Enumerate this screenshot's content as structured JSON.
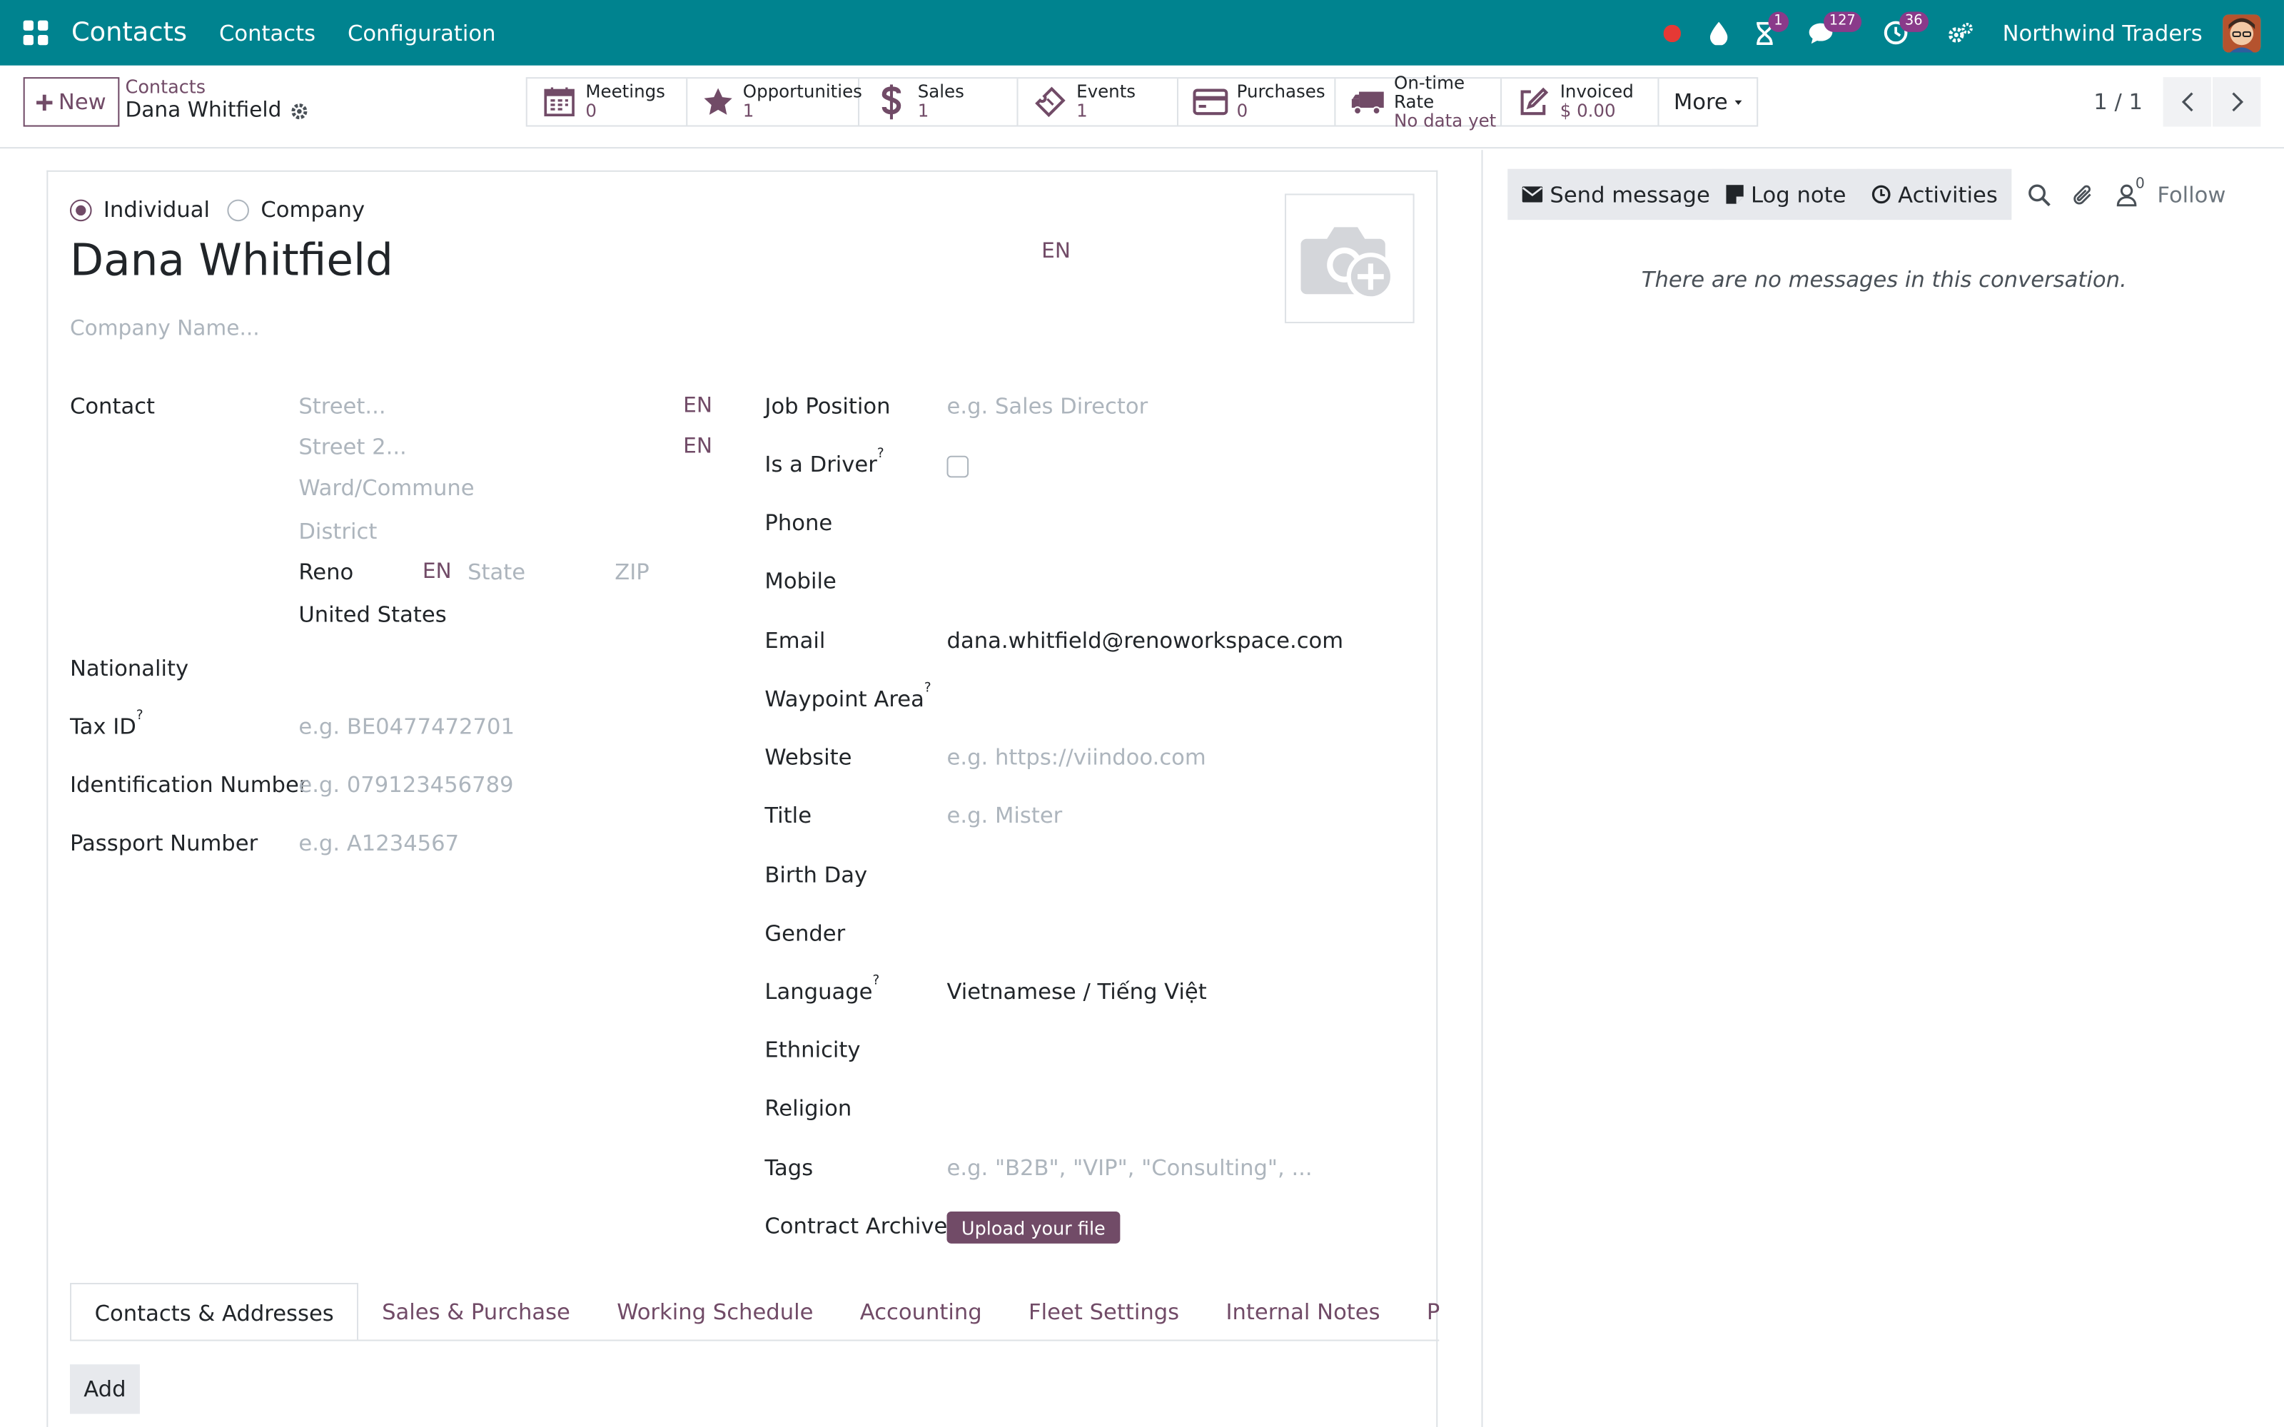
{
  "navbar": {
    "brand": "Contacts",
    "menus": [
      "Contacts",
      "Configuration"
    ],
    "badges": {
      "activities": "1",
      "messages": "127",
      "clock": "36"
    },
    "company": "Northwind Traders"
  },
  "control": {
    "new_label": "New",
    "breadcrumb_parent": "Contacts",
    "breadcrumb_current": "Dana Whitfield",
    "stats": [
      {
        "label": "Meetings",
        "value": "0",
        "icon": "calendar-icon"
      },
      {
        "label": "Opportunities",
        "value": "1",
        "icon": "star-icon"
      },
      {
        "label": "Sales",
        "value": "1",
        "icon": "dollar-icon"
      },
      {
        "label": "Events",
        "value": "1",
        "icon": "ticket-icon"
      },
      {
        "label": "Purchases",
        "value": "0",
        "icon": "credit-card-icon"
      },
      {
        "label": "On-time Rate",
        "value": "No data yet",
        "icon": "truck-icon"
      },
      {
        "label": "Invoiced",
        "value": "$ 0.00",
        "icon": "edit-icon"
      }
    ],
    "more_label": "More",
    "pager": "1 / 1"
  },
  "form": {
    "type_individual": "Individual",
    "type_company": "Company",
    "name": "Dana Whitfield",
    "lang_tag": "EN",
    "company_placeholder": "Company Name...",
    "left": {
      "contact_label": "Contact",
      "street_placeholder": "Street...",
      "street2_placeholder": "Street 2...",
      "ward_placeholder": "Ward/Commune",
      "district_placeholder": "District",
      "city": "Reno",
      "state_placeholder": "State",
      "zip_placeholder": "ZIP",
      "country": "United States",
      "nationality_label": "Nationality",
      "taxid_label": "Tax ID",
      "taxid_placeholder": "e.g. BE0477472701",
      "idnum_label": "Identification Number",
      "idnum_placeholder": "e.g. 079123456789",
      "passport_label": "Passport Number",
      "passport_placeholder": "e.g. A1234567"
    },
    "right": {
      "job_label": "Job Position",
      "job_placeholder": "e.g. Sales Director",
      "driver_label": "Is a Driver",
      "phone_label": "Phone",
      "mobile_label": "Mobile",
      "email_label": "Email",
      "email_value": "dana.whitfield@renoworkspace.com",
      "waypoint_label": "Waypoint Area",
      "website_label": "Website",
      "website_placeholder": "e.g. https://viindoo.com",
      "title_label": "Title",
      "title_placeholder": "e.g. Mister",
      "birthday_label": "Birth Day",
      "gender_label": "Gender",
      "language_label": "Language",
      "language_value": "Vietnamese / Tiếng Việt",
      "ethnicity_label": "Ethnicity",
      "religion_label": "Religion",
      "tags_label": "Tags",
      "tags_placeholder": "e.g. \"B2B\", \"VIP\", \"Consulting\", ...",
      "contract_label": "Contract Archive",
      "upload_label": "Upload your file"
    },
    "help_mark": "?",
    "tabs": [
      "Contacts & Addresses",
      "Sales & Purchase",
      "Working Schedule",
      "Accounting",
      "Fleet Settings",
      "Internal Notes",
      "Partner Assignation"
    ],
    "add_label": "Add"
  },
  "chatter": {
    "send_message": "Send message",
    "log_note": "Log note",
    "activities": "Activities",
    "followers_count": "0",
    "follow": "Follow",
    "empty": "There are no messages in this conversation."
  },
  "colors": {
    "navbar": "#00838f",
    "primary": "#714b67",
    "badge": "#8a3a8a"
  }
}
